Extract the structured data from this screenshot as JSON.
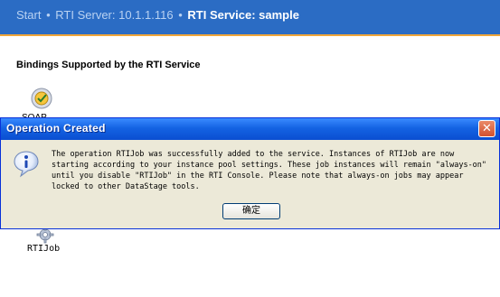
{
  "breadcrumb": {
    "start": "Start",
    "separator": "•",
    "server": "RTI Server: 10.1.1.116",
    "service": "RTI Service: sample"
  },
  "section": {
    "title": "Bindings Supported by the RTI Service"
  },
  "bindings": [
    {
      "label": "SOAP",
      "icon": "soap-binding-icon"
    }
  ],
  "jobs": [
    {
      "label": "RTIJob",
      "icon": "gear-icon"
    }
  ],
  "dialog": {
    "title": "Operation Created",
    "icon": "info-icon",
    "message_lines": [
      "The operation RTIJob was successfully added to the service. Instances of RTIJob are now",
      "starting according to your instance pool settings. These job instances will remain \"always-on\"",
      "until you disable \"RTIJob\" in the RTI Console. Please note that always-on jobs may appear",
      "locked to other DataStage tools."
    ],
    "ok_label": "确定",
    "close_symbol": "✕"
  },
  "colors": {
    "header": "#2b6cc4",
    "accent_rule": "#f0a63a",
    "dialog_title": "#1463e3",
    "dialog_bg": "#ece9d8"
  }
}
